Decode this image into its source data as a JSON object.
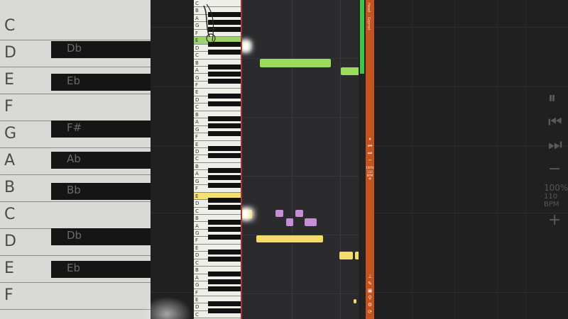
{
  "background": {
    "white_keys": [
      "C",
      "D",
      "E",
      "F",
      "G",
      "A",
      "B",
      "C",
      "D",
      "E",
      "F"
    ],
    "black_keys": [
      "Db",
      "Eb",
      "F#",
      "Ab",
      "Bb",
      "Db",
      "Eb"
    ],
    "zoom": "100%",
    "bpm": "110 BPM"
  },
  "keyboard": {
    "white_keys": [
      "C",
      "B",
      "A",
      "G",
      "F",
      "E",
      "D",
      "C",
      "B",
      "A",
      "G",
      "F",
      "E",
      "D",
      "C",
      "B",
      "A",
      "G",
      "F",
      "E",
      "D",
      "C",
      "B",
      "A",
      "G",
      "F",
      "E",
      "D",
      "C",
      "B",
      "A",
      "G",
      "F",
      "E",
      "D",
      "C",
      "B",
      "A",
      "G",
      "F",
      "E",
      "D",
      "C"
    ],
    "highlight_green_index": 5,
    "highlight_yellow_index": 26
  },
  "notes": {
    "colors": {
      "green": "#9bdc5a",
      "yellow": "#f4dc6a",
      "purple": "#c78ed8"
    }
  },
  "sidebar": {
    "label_top_a": "Head",
    "label_top_b": "Grpmst",
    "zoom": "100%",
    "bpm": "110 BPM",
    "accent": "#c5531e"
  },
  "meter": {
    "level": 0.23
  }
}
